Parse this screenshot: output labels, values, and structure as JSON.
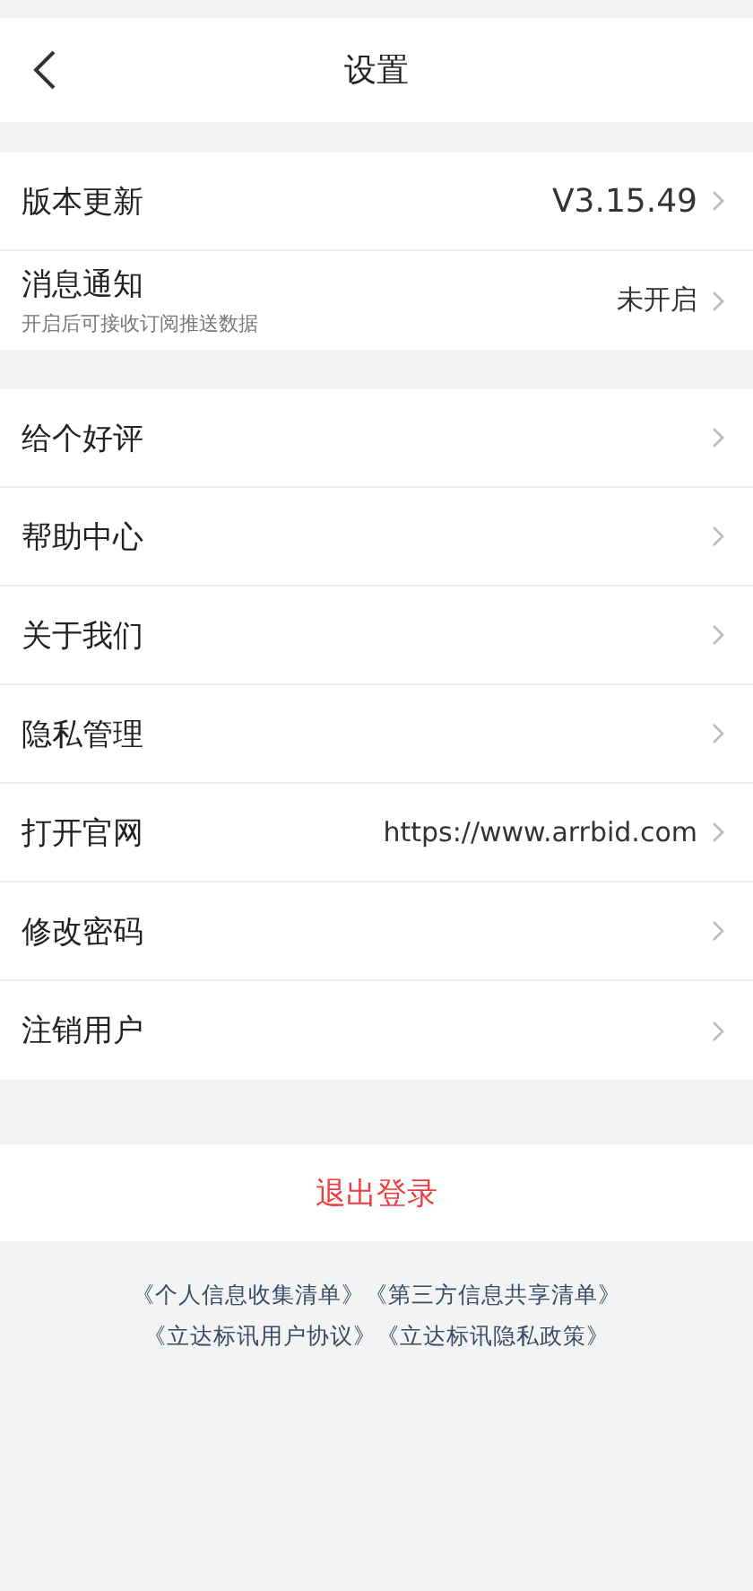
{
  "header": {
    "title": "设置"
  },
  "groups": [
    [
      {
        "kind": "version",
        "label": "版本更新",
        "value": "V3.15.49"
      },
      {
        "kind": "nav",
        "label": "消息通知",
        "sub": "开启后可接收订阅推送数据",
        "value": "未开启"
      }
    ],
    [
      {
        "kind": "nav",
        "label": "给个好评"
      },
      {
        "kind": "nav",
        "label": "帮助中心"
      },
      {
        "kind": "nav",
        "label": "关于我们"
      },
      {
        "kind": "nav",
        "label": "隐私管理"
      },
      {
        "kind": "nav",
        "label": "打开官网",
        "value": "https://www.arrbid.com"
      },
      {
        "kind": "nav",
        "label": "修改密码"
      },
      {
        "kind": "nav",
        "label": "注销用户"
      }
    ]
  ],
  "logout": "退出登录",
  "links": [
    [
      "《个人信息收集清单》",
      "《第三方信息共享清单》"
    ],
    [
      "《立达标讯用户协议》",
      "《立达标讯隐私政策》"
    ]
  ]
}
